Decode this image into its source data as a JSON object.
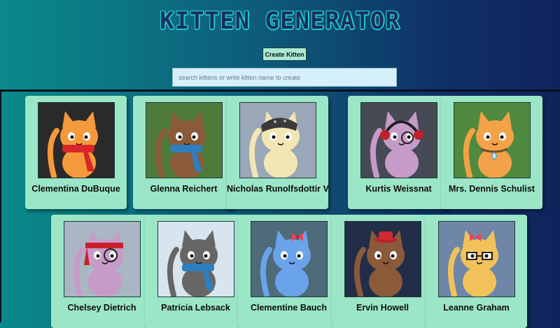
{
  "header": {
    "title": "KITTEN GENERATOR",
    "create_button_label": "Create Kitten",
    "search_placeholder": "search kittens or write kitten name to create",
    "search_value": ""
  },
  "kittens": [
    {
      "name": "Clementina DuBuque",
      "fur": "#f59a3a",
      "accessory": "red-scarf",
      "bg": "#2a2a2a"
    },
    {
      "name": "Glenna Reichert",
      "fur": "#8a5a3a",
      "accessory": "blue-scarf",
      "bg": "#4f7b3a"
    },
    {
      "name": "Nicholas Runolfsdottir V",
      "fur": "#f3e6b5",
      "accessory": "bandana",
      "bg": "#9aa7b8"
    },
    {
      "name": "Kurtis Weissnat",
      "fur": "#c69bc8",
      "accessory": "headphones-monocle",
      "bg": "#464a55"
    },
    {
      "name": "Mrs. Dennis Schulist",
      "fur": "#f4a24a",
      "accessory": "collar-gem",
      "bg": "#4f8a3e"
    },
    {
      "name": "Chelsey Dietrich",
      "fur": "#c69bc8",
      "accessory": "red-headband-monocle",
      "bg": "#a9b6c3"
    },
    {
      "name": "Patricia Lebsack",
      "fur": "#666666",
      "accessory": "blue-scarf",
      "bg": "#d8e4ee"
    },
    {
      "name": "Clementine Bauch",
      "fur": "#6aa3ea",
      "accessory": "bow",
      "bg": "#4f6a78"
    },
    {
      "name": "Ervin Howell",
      "fur": "#8a5a3a",
      "accessory": "red-hat",
      "bg": "#222e48"
    },
    {
      "name": "Leanne Graham",
      "fur": "#f2c25a",
      "accessory": "bow-glasses",
      "bg": "#6f86a8"
    }
  ],
  "colors": {
    "card": "#9ce6c8",
    "accent": "#22d6d6",
    "gradient_start": "#0a8a8a",
    "gradient_end": "#10245c"
  }
}
